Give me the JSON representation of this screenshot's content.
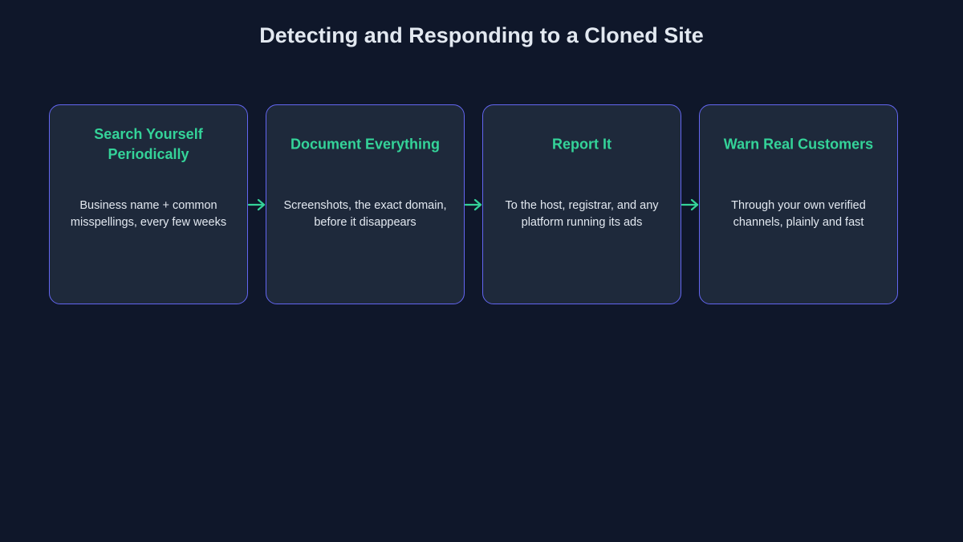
{
  "title": "Detecting and Responding to a Cloned Site",
  "colors": {
    "background": "#0f172a",
    "card_fill": "#1e293b",
    "card_border": "#6366f1",
    "step_title": "#34d399",
    "text": "#e2e8f0",
    "arrow": "#34d399"
  },
  "steps": [
    {
      "title": "Search Yourself Periodically",
      "description": "Business name + common misspellings, every few weeks"
    },
    {
      "title": "Document Everything",
      "description": "Screenshots, the exact domain, before it disappears"
    },
    {
      "title": "Report It",
      "description": "To the host, registrar, and any platform running its ads"
    },
    {
      "title": "Warn Real Customers",
      "description": "Through your own verified channels, plainly and fast"
    }
  ]
}
